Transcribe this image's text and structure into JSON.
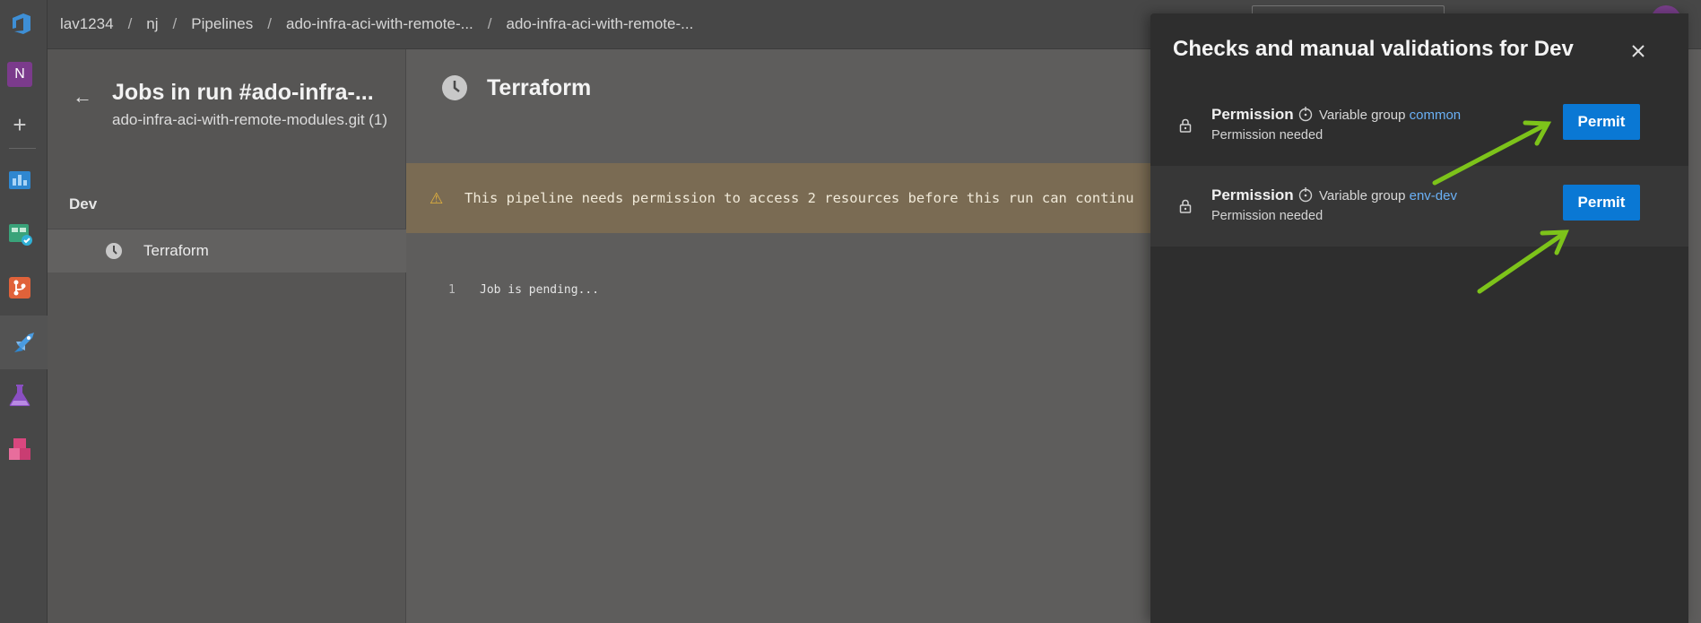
{
  "breadcrumbs": [
    "lav1234",
    "nj",
    "Pipelines",
    "ado-infra-aci-with-remote-...",
    "ado-infra-aci-with-remote-..."
  ],
  "breadcrumb_separator": "/",
  "rail": {
    "org_initial": "N",
    "add_symbol": "+",
    "icons": [
      "azure-devops-logo",
      "overview-icon",
      "boards-icon",
      "repos-icon",
      "pipelines-icon",
      "test-plans-icon",
      "artifacts-icon"
    ]
  },
  "jobs_panel": {
    "back_symbol": "←",
    "title": "Jobs in run #ado-infra-...",
    "subtitle": "ado-infra-aci-with-remote-modules.git (1)",
    "stage": "Dev",
    "job": "Terraform"
  },
  "main": {
    "title": "Terraform",
    "banner_icon": "⚠",
    "banner_text": "This pipeline needs permission to access 2 resources before this run can continu",
    "log_lines": [
      {
        "number": "1",
        "text": "Job is pending..."
      }
    ]
  },
  "panel": {
    "title": "Checks and manual validations for Dev",
    "checks": [
      {
        "title": "Permission",
        "resource_type": "Variable group",
        "resource_name": "common",
        "status": "Permission needed",
        "button": "Permit"
      },
      {
        "title": "Permission",
        "resource_type": "Variable group",
        "resource_name": "env-dev",
        "status": "Permission needed",
        "button": "Permit"
      }
    ]
  },
  "colors": {
    "accent": "#0a78d4",
    "link": "#6ab0f5",
    "warning": "#e3b23c",
    "annotation_arrow": "#7dc31a"
  }
}
